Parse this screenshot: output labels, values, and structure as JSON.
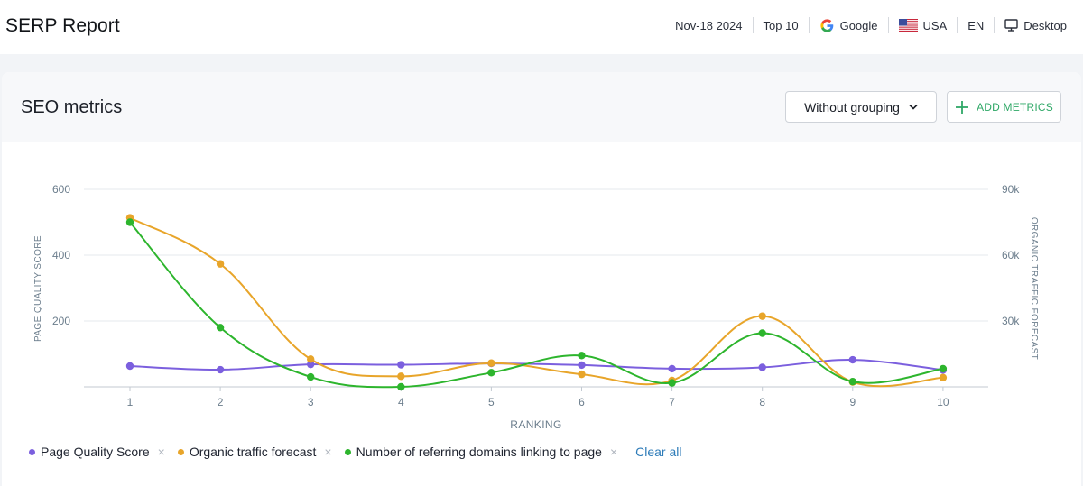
{
  "header": {
    "title": "SERP Report",
    "date": "Nov-18 2024",
    "top": "Top 10",
    "engine": "Google",
    "country": "USA",
    "language": "EN",
    "device": "Desktop"
  },
  "panel": {
    "title": "SEO metrics",
    "grouping_label": "Without grouping",
    "add_metrics_label": "ADD METRICS"
  },
  "colors": {
    "page_quality": "#7b5fde",
    "organic_traffic": "#e8a52a",
    "ref_domains": "#2db52d",
    "accent_green": "#2fa867",
    "link_blue": "#2d7bb8"
  },
  "chart_data": {
    "type": "line",
    "xlabel": "RANKING",
    "ylabel_left": "PAGE QUALITY SCORE",
    "ylabel_right": "ORGANIC TRAFFIC FORECAST",
    "x": [
      1,
      2,
      3,
      4,
      5,
      6,
      7,
      8,
      9,
      10
    ],
    "ylim_left": [
      0,
      600
    ],
    "ylim_right": [
      0,
      90000
    ],
    "yticks_left": [
      "200",
      "400",
      "600"
    ],
    "yticks_right": [
      "30k",
      "60k",
      "90k"
    ],
    "yticks_left_values": [
      200,
      400,
      600
    ],
    "yticks_right_values": [
      30000,
      60000,
      90000
    ],
    "grid": true,
    "legend_position": "bottom-left",
    "series": [
      {
        "name": "Page Quality Score",
        "axis": "left",
        "color_key": "page_quality",
        "values": [
          63,
          52,
          68,
          67,
          71,
          66,
          55,
          59,
          82,
          51
        ]
      },
      {
        "name": "Organic traffic forecast",
        "axis": "right",
        "color_key": "organic_traffic",
        "values": [
          77000,
          56000,
          12600,
          4800,
          10800,
          5700,
          2900,
          32200,
          2200,
          4200
        ]
      },
      {
        "name": "Number of referring domains linking to page",
        "axis": "left",
        "color_key": "ref_domains",
        "values": [
          500,
          180,
          30,
          0,
          43,
          95,
          12,
          163,
          16,
          55
        ]
      }
    ]
  },
  "legend": {
    "clear_all": "Clear all",
    "remove_symbol": "×"
  }
}
